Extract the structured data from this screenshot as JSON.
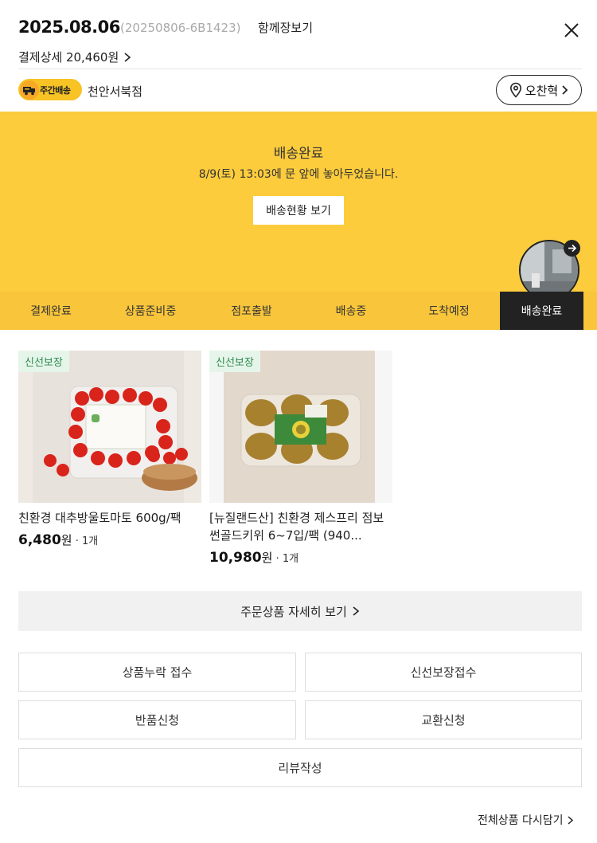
{
  "header": {
    "date": "2025.08.06",
    "order_number": "(20250806-6B1423)",
    "together_link": "함께장보기",
    "payment_detail": "결제상세 20,460원"
  },
  "store": {
    "badge_label": "주간배송",
    "name": "천안서북점",
    "user_name": "오찬혁"
  },
  "delivery": {
    "status_title": "배송완료",
    "status_desc": "8/9(토) 13:03에 문 앞에 놓아두었습니다.",
    "track_button": "배송현황 보기"
  },
  "steps": [
    {
      "label": "결제완료",
      "active": false
    },
    {
      "label": "상품준비중",
      "active": false
    },
    {
      "label": "점포출발",
      "active": false
    },
    {
      "label": "배송중",
      "active": false
    },
    {
      "label": "도착예정",
      "active": false
    },
    {
      "label": "배송완료",
      "active": true
    }
  ],
  "products": [
    {
      "tag": "신선보장",
      "name": "친환경 대추방울토마토 600g/팩",
      "price": "6,480",
      "price_unit": "원",
      "qty": "1개"
    },
    {
      "tag": "신선보장",
      "name": "[뉴질랜드산] 친환경 제스프리 점보 썬골드키위 6~7입/팩 (940...",
      "price": "10,980",
      "price_unit": "원",
      "qty": "1개"
    }
  ],
  "detail_button": "주문상품 자세히 보기",
  "actions": {
    "missing": "상품누락 접수",
    "fresh_guarantee": "신선보장접수",
    "return": "반품신청",
    "exchange": "교환신청",
    "review": "리뷰작성"
  },
  "reorder_link": "전체상품 다시담기",
  "colors": {
    "banner": "#fccc3d",
    "steps_bar": "#f8c53b",
    "active_step": "#222222",
    "fresh_tag_text": "#2b8a4e"
  }
}
